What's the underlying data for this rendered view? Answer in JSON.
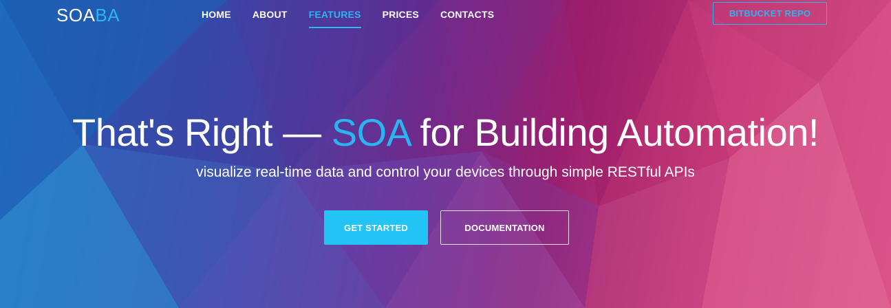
{
  "brand": {
    "logo_main": "SOA",
    "logo_accent": "BA"
  },
  "nav": {
    "items": [
      {
        "label": "HOME"
      },
      {
        "label": "ABOUT"
      },
      {
        "label": "FEATURES",
        "active": true
      },
      {
        "label": "PRICES"
      },
      {
        "label": "CONTACTS"
      }
    ],
    "repo_button": "BITBUCKET REPO"
  },
  "hero": {
    "headline_pre": "That's Right — ",
    "headline_accent": "SOA",
    "headline_post": " for Building Automation!",
    "subtitle": "visualize real-time data and control your devices through simple RESTful APIs",
    "primary_button": "GET STARTED",
    "secondary_button": "DOCUMENTATION"
  },
  "colors": {
    "accent": "#2bb5f0",
    "primary_button": "#22c3f5",
    "text": "#ffffff"
  }
}
